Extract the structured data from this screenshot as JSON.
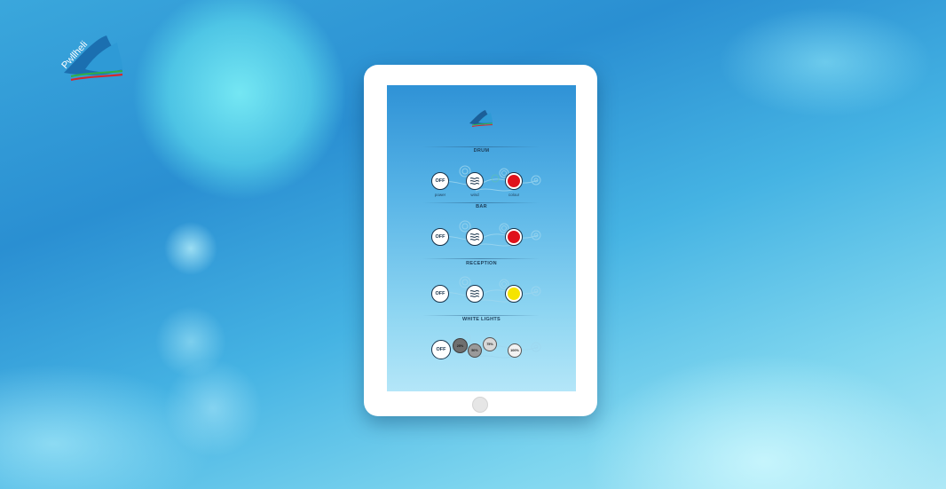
{
  "brand": {
    "logo_text": "Pwllheli"
  },
  "panel": {
    "sections": [
      {
        "title": "DRUM",
        "power_label": "OFF",
        "captions": {
          "power": "power",
          "wind": "wind",
          "colour": "colour"
        },
        "colour": "#e0121b"
      },
      {
        "title": "BAR",
        "power_label": "OFF",
        "colour": "#e0121b"
      },
      {
        "title": "RECEPTION",
        "power_label": "OFF",
        "colour": "#f5e400"
      },
      {
        "title": "WHITE LIGHTS",
        "power_label": "OFF",
        "levels": [
          "25%",
          "50%",
          "75%",
          "100%"
        ]
      }
    ]
  },
  "colors": {
    "accent_dark": "#16324a",
    "red": "#e0121b",
    "yellow": "#f5e400"
  },
  "icons": [
    "wind-icon",
    "swirl-decoration",
    "sail-logo-icon"
  ]
}
